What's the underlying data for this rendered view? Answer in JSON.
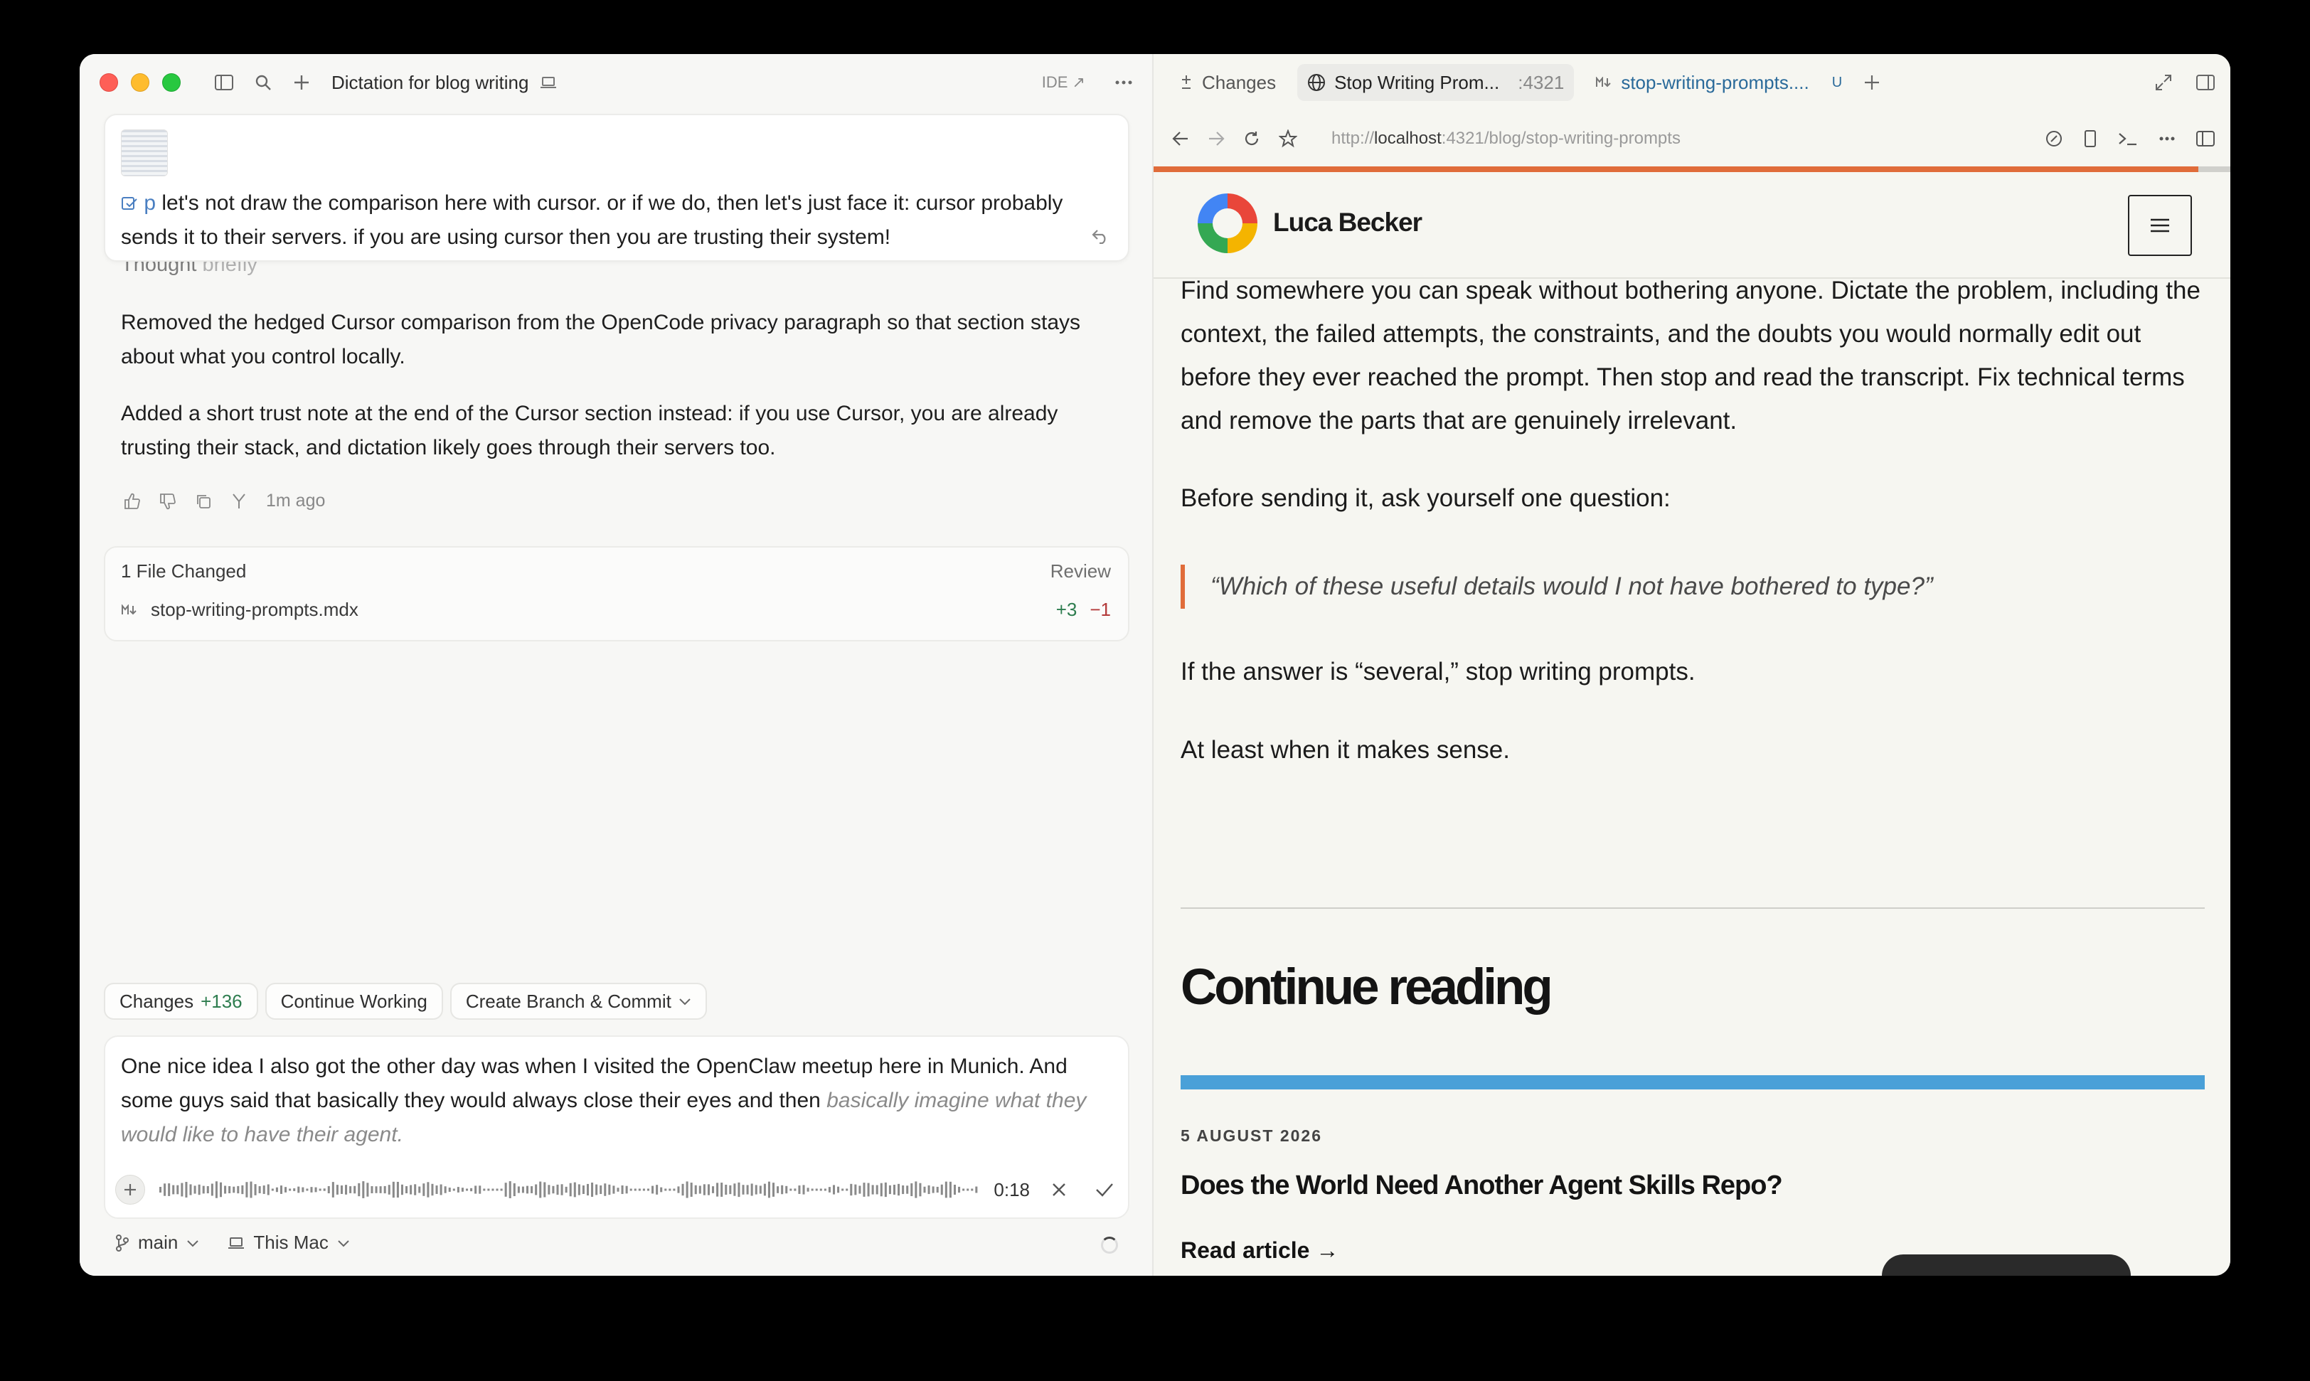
{
  "left": {
    "title": "Dictation for blog writing",
    "ide_label": "IDE ↗",
    "message": {
      "ref_label": "p",
      "text": "let's not draw the comparison here with cursor. or if we do, then let's just face it: cursor probably sends it to their servers. if you are using cursor then you are trusting their system!"
    },
    "thought": {
      "label": "Thought",
      "suffix": "briefly"
    },
    "paragraphs": [
      "Removed the hedged Cursor comparison from the OpenCode privacy paragraph so that section stays about what you control locally.",
      "Added a short trust note at the end of the Cursor section instead: if you use Cursor, you are already trusting their stack, and dictation likely goes through their servers too."
    ],
    "timestamp": "1m ago",
    "files_changed": {
      "header": "1 File Changed",
      "review": "Review",
      "file": "stop-writing-prompts.mdx",
      "added": "+3",
      "removed": "−1"
    },
    "chips": {
      "changes": "Changes",
      "changes_count": "+136",
      "continue": "Continue Working",
      "branch_commit": "Create Branch & Commit"
    },
    "composer": {
      "text": "One nice idea I also got the other day was when I visited the OpenClaw meetup here in Munich. And some guys said that basically they would always close their eyes and then ",
      "text_italic": "basically imagine what they would like to have their agent.",
      "time": "0:18"
    },
    "footer": {
      "branch": "main",
      "machine": "This Mac"
    }
  },
  "right": {
    "tabs": {
      "changes": "Changes",
      "browser": "Stop Writing Prom...",
      "port": ":4321",
      "file": "stop-writing-prompts....",
      "file_badge": "U"
    },
    "url": {
      "prefix": "http://",
      "host": "localhost",
      "rest": ":4321/blog/stop-writing-prompts"
    },
    "scroll_progress": 0.97,
    "site_name": "Luca Becker",
    "article": {
      "p1": "Find somewhere you can speak without bothering anyone. Dictate the problem, including the context, the failed attempts, the constraints, and the doubts you would normally edit out before they ever reached the prompt. Then stop and read the transcript. Fix technical terms and remove the parts that are genuinely irrelevant.",
      "p2": "Before sending it, ask yourself one question:",
      "quote": "“Which of these useful details would I not have bothered to type?”",
      "p3": "If the answer is “several,” stop writing prompts.",
      "p4": "At least when it makes sense.",
      "continue": "Continue reading",
      "next_date": "5 AUGUST 2026",
      "next_title": "Does the World Need Another Agent Skills Repo?",
      "read_more": "Read article →"
    }
  },
  "colors": {
    "accent_orange": "#e06c3a",
    "blue_bar": "#4aa0d8",
    "green": "#2e7d4f",
    "red": "#b33a3a"
  }
}
